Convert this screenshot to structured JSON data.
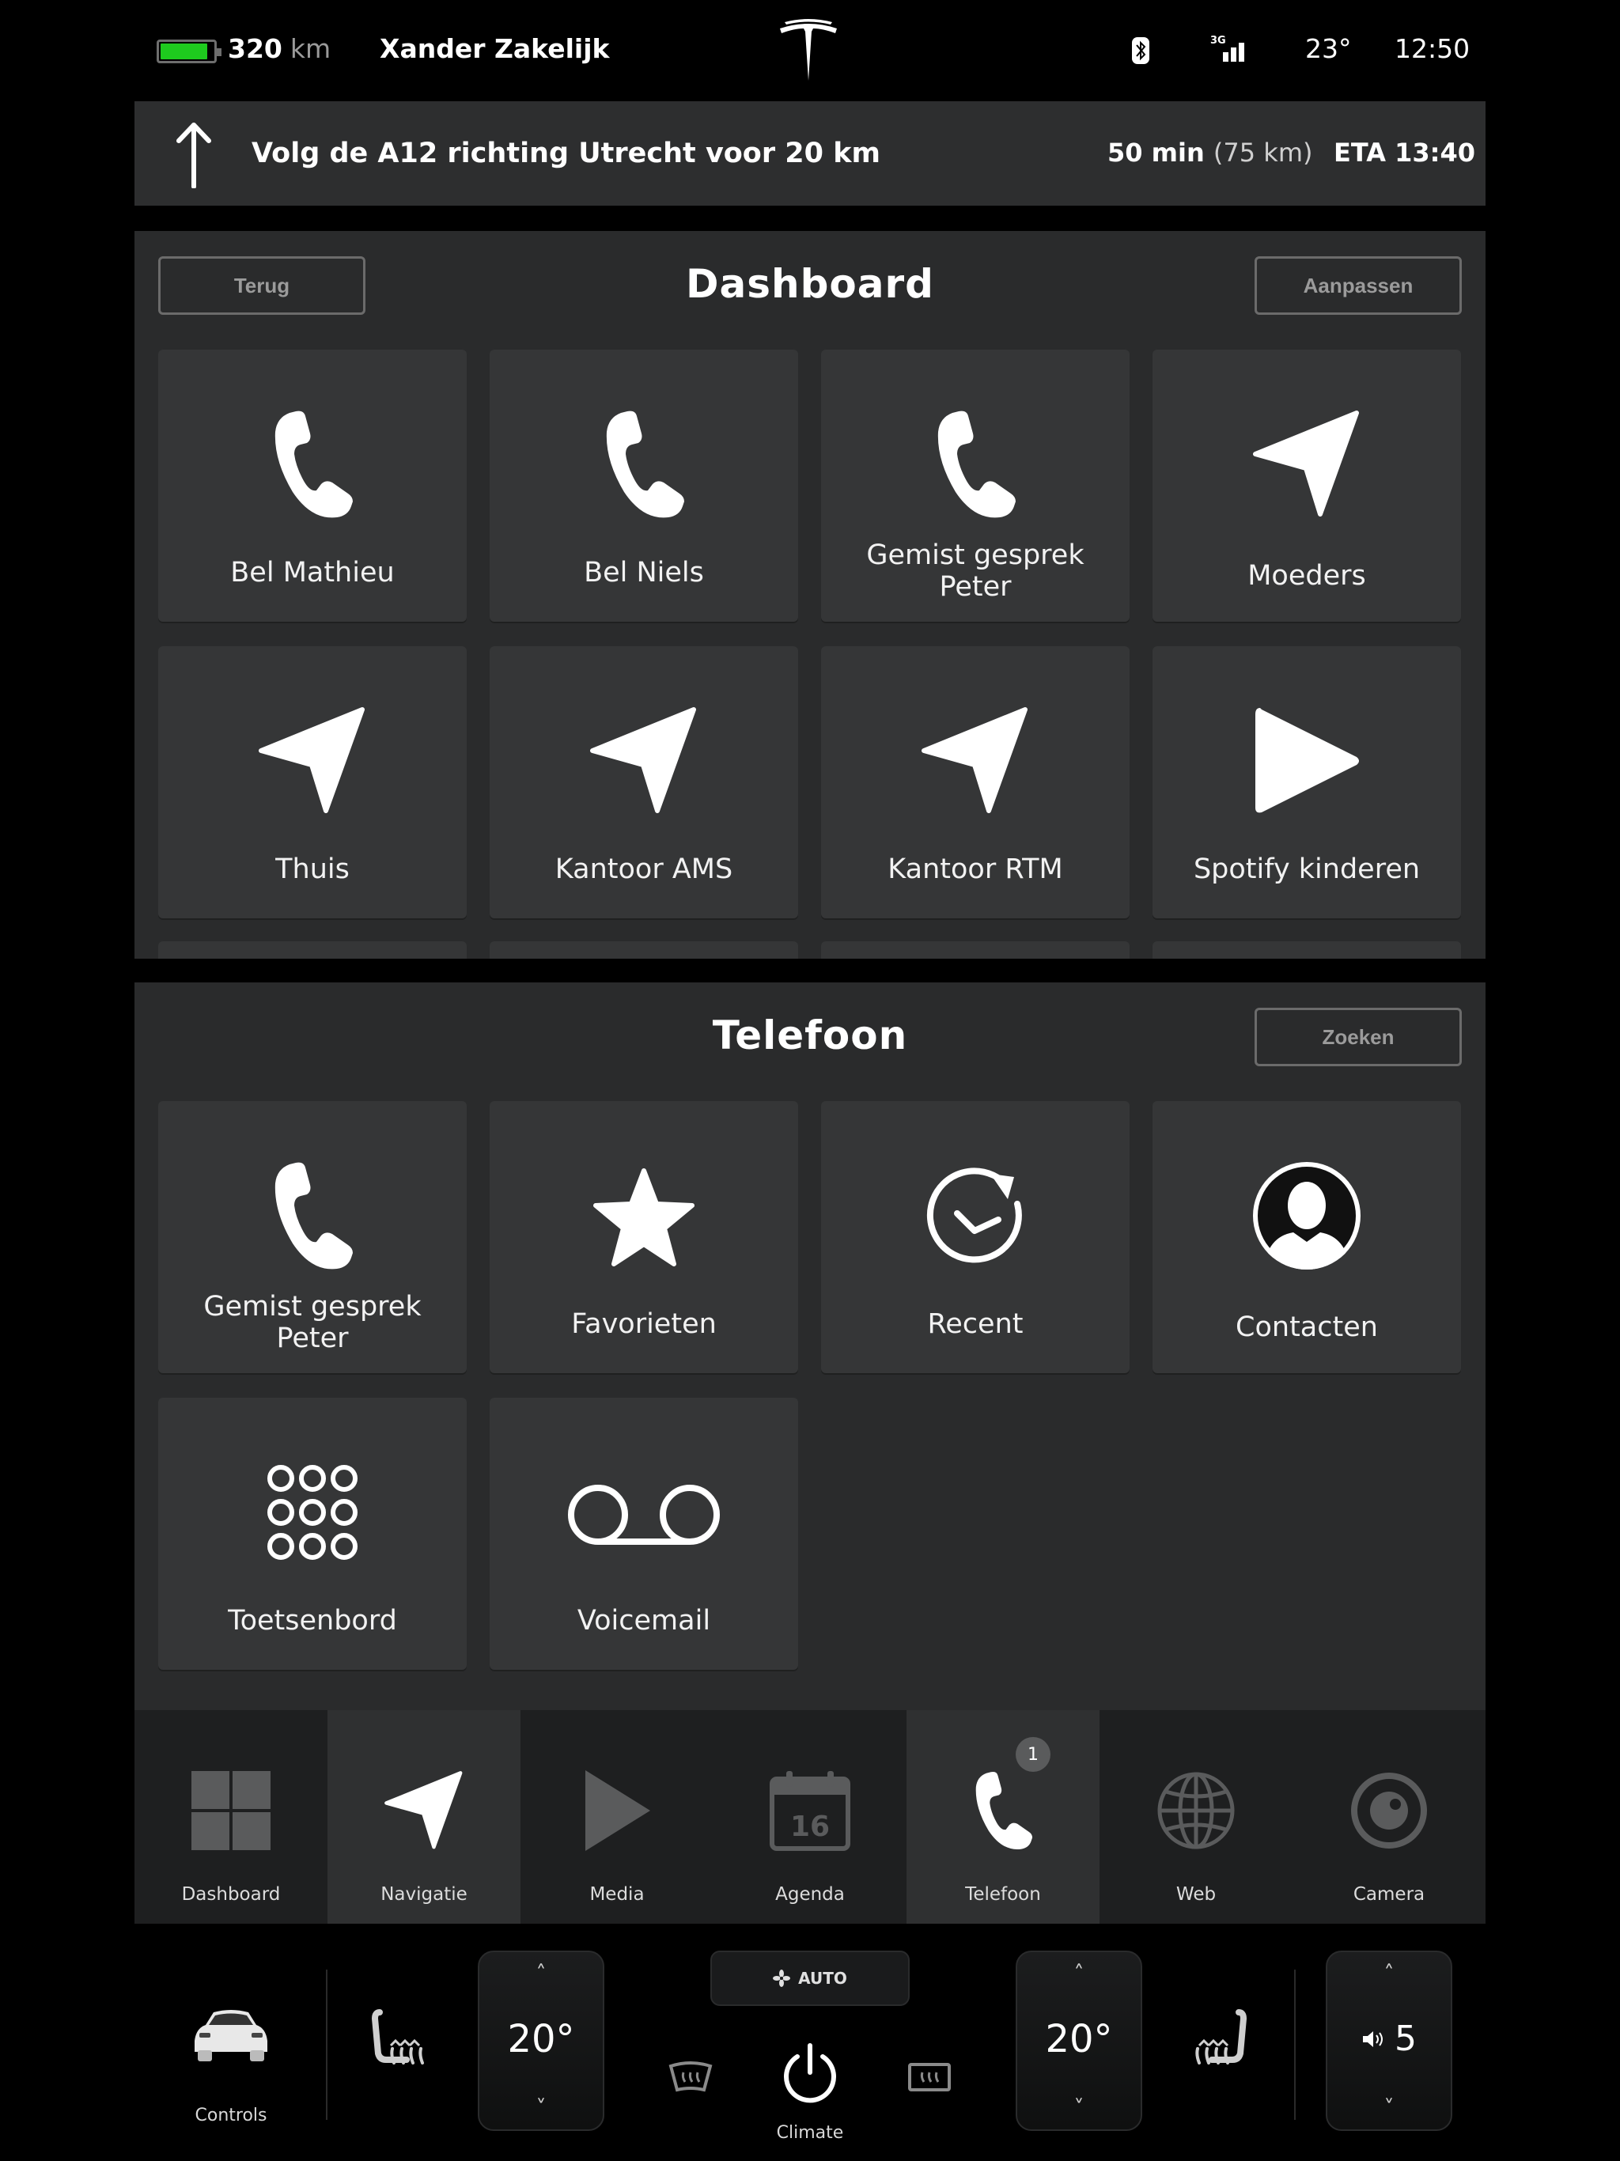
{
  "status": {
    "range_value": "320",
    "range_unit": "km",
    "driver": "Xander Zakelijk",
    "network": "3G",
    "temperature": "23°",
    "time": "12:50",
    "battery_level": 0.9,
    "battery_color": "#1ecb1e"
  },
  "navigation": {
    "instruction": "Volg de A12 richting Utrecht voor 20 km",
    "duration": "50 min",
    "distance": "(75 km)",
    "eta": "ETA 13:40"
  },
  "dashboard": {
    "title": "Dashboard",
    "back_label": "Terug",
    "customize_label": "Aanpassen",
    "tiles": [
      {
        "label": "Bel Mathieu",
        "icon": "phone-icon"
      },
      {
        "label": "Bel Niels",
        "icon": "phone-icon"
      },
      {
        "label_line1": "Gemist gesprek",
        "label_line2": "Peter",
        "icon": "phone-icon"
      },
      {
        "label": "Moeders",
        "icon": "navigation-arrow-icon"
      },
      {
        "label": "Thuis",
        "icon": "navigation-arrow-icon"
      },
      {
        "label": "Kantoor AMS",
        "icon": "navigation-arrow-icon"
      },
      {
        "label": "Kantoor RTM",
        "icon": "navigation-arrow-icon"
      },
      {
        "label": "Spotify kinderen",
        "icon": "play-icon"
      }
    ]
  },
  "phone": {
    "title": "Telefoon",
    "search_label": "Zoeken",
    "tiles": [
      {
        "label_line1": "Gemist gesprek",
        "label_line2": "Peter",
        "icon": "phone-icon"
      },
      {
        "label": "Favorieten",
        "icon": "star-icon"
      },
      {
        "label": "Recent",
        "icon": "recent-icon"
      },
      {
        "label": "Contacten",
        "icon": "contact-icon"
      },
      {
        "label": "Toetsenbord",
        "icon": "keypad-icon"
      },
      {
        "label": "Voicemail",
        "icon": "voicemail-icon"
      }
    ]
  },
  "dock": {
    "items": [
      {
        "label": "Dashboard",
        "icon": "grid-icon"
      },
      {
        "label": "Navigatie",
        "icon": "navigation-arrow-icon"
      },
      {
        "label": "Media",
        "icon": "play-icon"
      },
      {
        "label": "Agenda",
        "icon": "calendar-icon",
        "day": "16"
      },
      {
        "label": "Telefoon",
        "icon": "phone-icon",
        "badge": "1"
      },
      {
        "label": "Web",
        "icon": "globe-icon"
      },
      {
        "label": "Camera",
        "icon": "camera-icon"
      }
    ]
  },
  "climate": {
    "controls_label": "Controls",
    "left_temp": "20°",
    "right_temp": "20°",
    "auto_label": "AUTO",
    "climate_label": "Climate",
    "volume": "5",
    "up_glyph": "˄",
    "down_glyph": "˅"
  }
}
